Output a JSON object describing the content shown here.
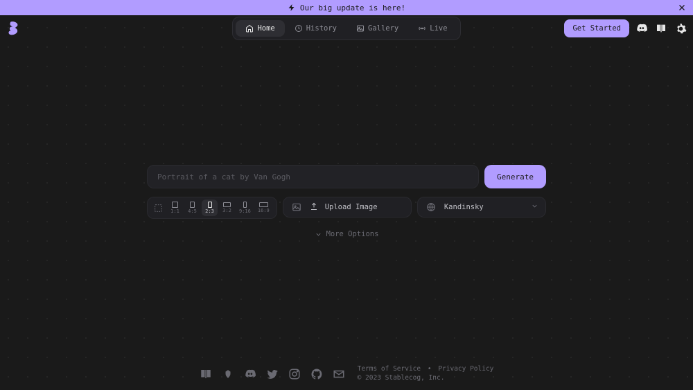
{
  "banner": {
    "text": "Our big update is here!"
  },
  "nav": {
    "home": "Home",
    "history": "History",
    "gallery": "Gallery",
    "live": "Live"
  },
  "topbar": {
    "get_started": "Get Started"
  },
  "prompt": {
    "placeholder": "Portrait of a cat by Van Gogh",
    "generate": "Generate"
  },
  "aspects": [
    {
      "label": "1:1",
      "w": 9,
      "h": 9
    },
    {
      "label": "4:5",
      "w": 7,
      "h": 9
    },
    {
      "label": "2:3",
      "w": 6,
      "h": 9
    },
    {
      "label": "3:2",
      "w": 11,
      "h": 7
    },
    {
      "label": "9:16",
      "w": 5,
      "h": 9
    },
    {
      "label": "16:9",
      "w": 13,
      "h": 7
    }
  ],
  "aspect_active_index": 2,
  "upload": {
    "label": "Upload Image"
  },
  "model": {
    "selected": "Kandinsky"
  },
  "more_options": "More Options",
  "footer": {
    "terms": "Terms of Service",
    "privacy": "Privacy Policy",
    "copyright": "© 2023 Stablecog, Inc."
  }
}
